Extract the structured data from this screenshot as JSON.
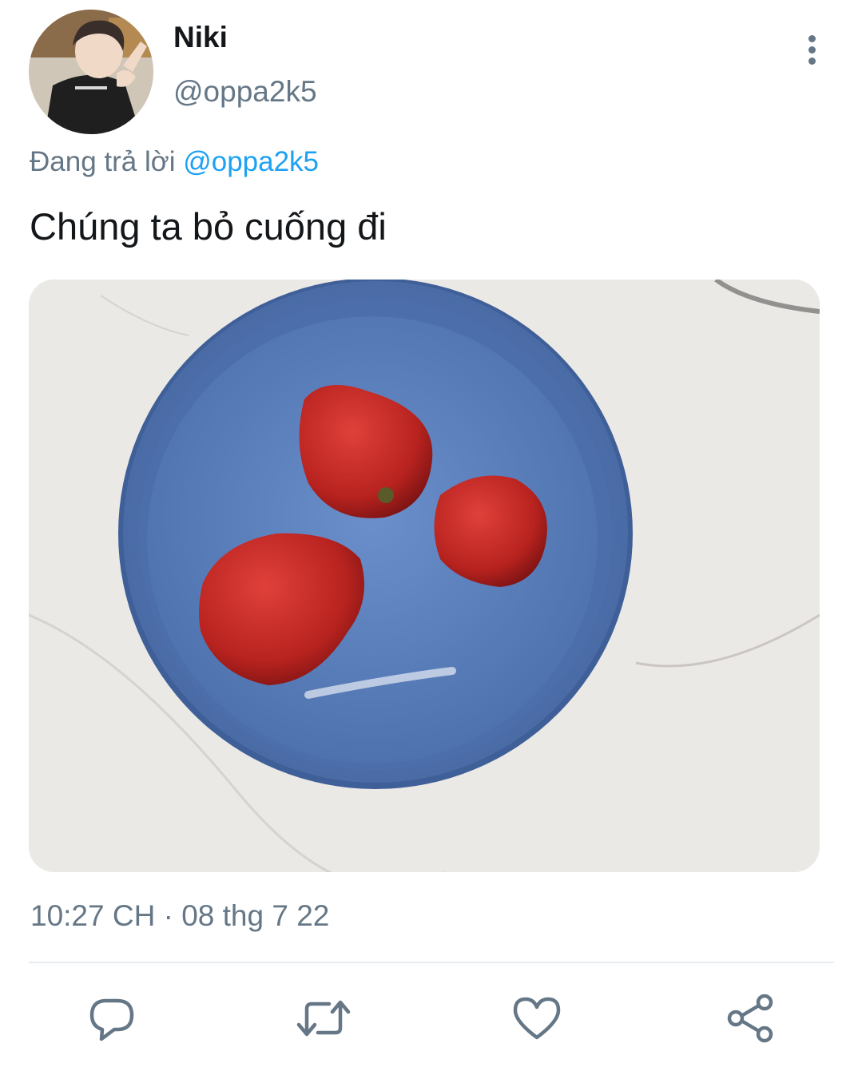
{
  "tweet": {
    "author_name": "Niki",
    "author_handle": "@oppa2k5",
    "reply_prefix": "Đang trả lời",
    "reply_mention": "@oppa2k5",
    "text": "Chúng ta bỏ cuống đi",
    "timestamp": "10:27 CH · 08 thg 7 22"
  },
  "icons": {
    "more": "more-vertical-icon",
    "reply": "reply-icon",
    "retweet": "retweet-icon",
    "like": "heart-icon",
    "share": "share-icon"
  },
  "colors": {
    "primary_text": "#14171a",
    "secondary_text": "#657786",
    "link": "#1da1f2",
    "icon": "#657786",
    "divider": "#e6ecf0",
    "bowl": "#5577b0",
    "strawberry": "#c62a2c"
  }
}
